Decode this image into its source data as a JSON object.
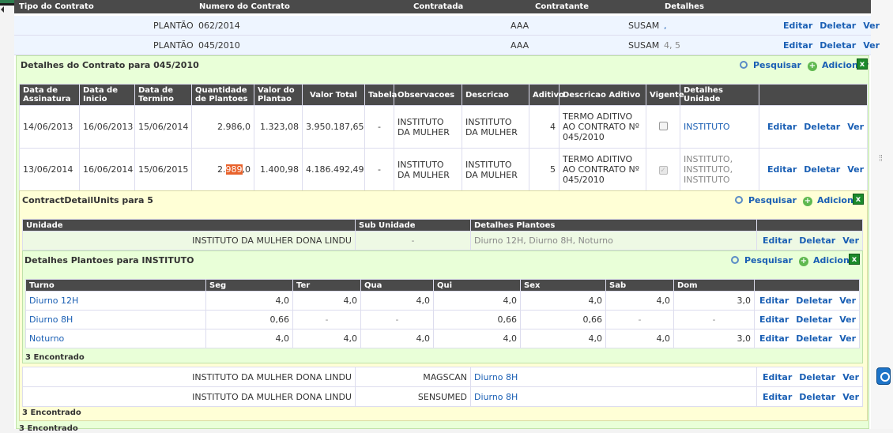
{
  "top_header": {
    "col1": "Tipo do Contrato",
    "col2": "Numero do Contrato",
    "col3": "Contratada",
    "col4": "Contratante",
    "col5": "Detalhes"
  },
  "contracts": [
    {
      "tipo": "PLANTÃO",
      "numero": "062/2014",
      "contratada": "AAA",
      "contratante": "SUSAM",
      "detalhes": ","
    },
    {
      "tipo": "PLANTÃO",
      "numero": "045/2010",
      "contratada": "AAA",
      "contratante": "SUSAM",
      "detalhes": "4, 5"
    }
  ],
  "actions": {
    "edit": "Editar",
    "delete": "Deletar",
    "view": "Ver"
  },
  "tools": {
    "search": "Pesquisar",
    "add": "Adicionar",
    "close": "x"
  },
  "details_section": {
    "title": "Detalhes do Contrato para 045/2010",
    "headers": [
      "Data de Assinatura",
      "Data de Inicio",
      "Data de Termino",
      "Quantidade de Plantoes",
      "Valor do Plantao",
      "Valor Total",
      "Tabela",
      "Observacoes",
      "Descricao",
      "Aditivo",
      "Descricao Aditivo",
      "Vigente",
      "Detalhes Unidade"
    ],
    "rows": [
      {
        "assinatura": "14/06/2013",
        "inicio": "16/06/2013",
        "termino": "15/06/2014",
        "qtd": "2.986,0",
        "valor": "1.323,08",
        "total": "3.950.187,65",
        "tabela": "-",
        "obs": "INSTITUTO DA MULHER",
        "desc": "INSTITUTO DA MULHER",
        "aditivo": "4",
        "desc_aditivo": "TERMO ADITIVO AO CONTRATO Nº 045/2010",
        "vigente": false,
        "unidade": "INSTITUTO"
      },
      {
        "assinatura": "13/06/2014",
        "inicio": "16/06/2014",
        "termino": "15/06/2015",
        "qtd_pre": "2.",
        "qtd_hl": "989",
        "qtd_post": ",0",
        "valor": "1.400,98",
        "total": "4.186.492,49",
        "tabela": "-",
        "obs": "INSTITUTO DA MULHER",
        "desc": "INSTITUTO DA MULHER",
        "aditivo": "5",
        "desc_aditivo": "TERMO ADITIVO AO CONTRATO Nº 045/2010",
        "vigente": true,
        "unidade": "INSTITUTO, INSTITUTO, INSTITUTO"
      }
    ]
  },
  "units_section": {
    "title": "ContractDetailUnits para 5",
    "headers": [
      "Unidade",
      "Sub Unidade",
      "Detalhes Plantoes"
    ],
    "rows": [
      {
        "unidade": "INSTITUTO DA MULHER DONA LINDU",
        "sub": "-",
        "detalhes": "Diurno 12H, Diurno 8H, Noturno"
      },
      {
        "unidade": "INSTITUTO DA MULHER DONA LINDU",
        "sub": "MAGSCAN",
        "detalhes": "Diurno 8H"
      },
      {
        "unidade": "INSTITUTO DA MULHER DONA LINDU",
        "sub": "SENSUMED",
        "detalhes": "Diurno 8H"
      }
    ],
    "footer": "3 Encontrado"
  },
  "plantoes_section": {
    "title": "Detalhes Plantoes para INSTITUTO",
    "headers": [
      "Turno",
      "Seg",
      "Ter",
      "Qua",
      "Qui",
      "Sex",
      "Sab",
      "Dom"
    ],
    "rows": [
      {
        "turno": "Diurno 12H",
        "seg": "4,0",
        "ter": "4,0",
        "qua": "4,0",
        "qui": "4,0",
        "sex": "4,0",
        "sab": "4,0",
        "dom": "3,0"
      },
      {
        "turno": "Diurno 8H",
        "seg": "0,66",
        "ter": "-",
        "qua": "-",
        "qui": "0,66",
        "sex": "0,66",
        "sab": "-",
        "dom": "-"
      },
      {
        "turno": "Noturno",
        "seg": "4,0",
        "ter": "4,0",
        "qua": "4,0",
        "qui": "4,0",
        "sex": "4,0",
        "sab": "4,0",
        "dom": "3,0"
      }
    ],
    "footer": "3 Encontrado"
  },
  "bottom_footer": "3 Encontrado"
}
